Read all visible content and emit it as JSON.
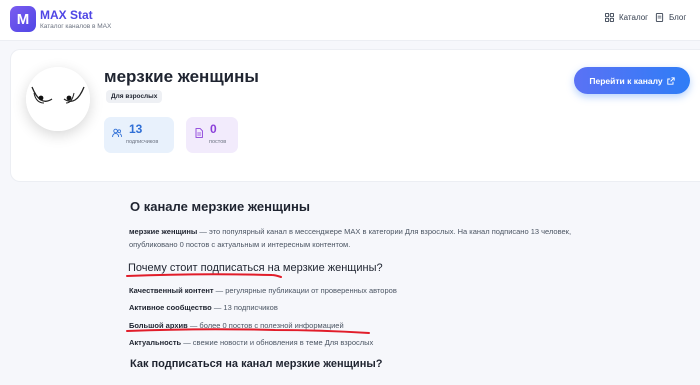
{
  "header": {
    "logo_letter": "M",
    "brand_name": "MAX Stat",
    "brand_subtitle": "Каталог каналов в MAX",
    "nav": [
      {
        "label": "Каталог",
        "icon": "grid-icon"
      },
      {
        "label": "Блог",
        "icon": "document-icon"
      }
    ]
  },
  "channel": {
    "title": "мерзкие женщины",
    "category": "Для взрослых",
    "subscribers": {
      "value": "13",
      "label": "подписчиков",
      "icon": "users-icon"
    },
    "posts": {
      "value": "0",
      "label": "постов",
      "icon": "file-icon"
    },
    "cta": "Перейти к каналу",
    "cta_icon": "external-link-icon"
  },
  "about": {
    "heading": "О канале мерзкие женщины",
    "intro_bold": "мерзкие женщины",
    "intro_rest": " — это популярный канал в мессенджере MAX в категории Для взрослых. На канал подписано 13 человек, опубликовано 0 постов с актуальным и интересным контентом.",
    "why_heading": "Почему стоит подписаться на мерзкие женщины?",
    "features": [
      {
        "bold": "Качественный контент",
        "rest": " — регулярные публикации от проверенных авторов"
      },
      {
        "bold": "Активное сообщество",
        "rest": " — 13 подписчиков"
      },
      {
        "bold": "Большой архив",
        "rest": " — более 0 постов с полезной информацией"
      },
      {
        "bold": "Актуальность",
        "rest": " — свежие новости и обновления в теме Для взрослых"
      }
    ],
    "how_heading": "Как подписаться на канал мерзкие женщины?"
  },
  "colors": {
    "brand": "#4f46e5",
    "cta_blue": "#2f7df6",
    "subs_bg": "#e8f1fc",
    "posts_bg": "#f2ebfc",
    "annotation_red": "#e11d2a"
  }
}
